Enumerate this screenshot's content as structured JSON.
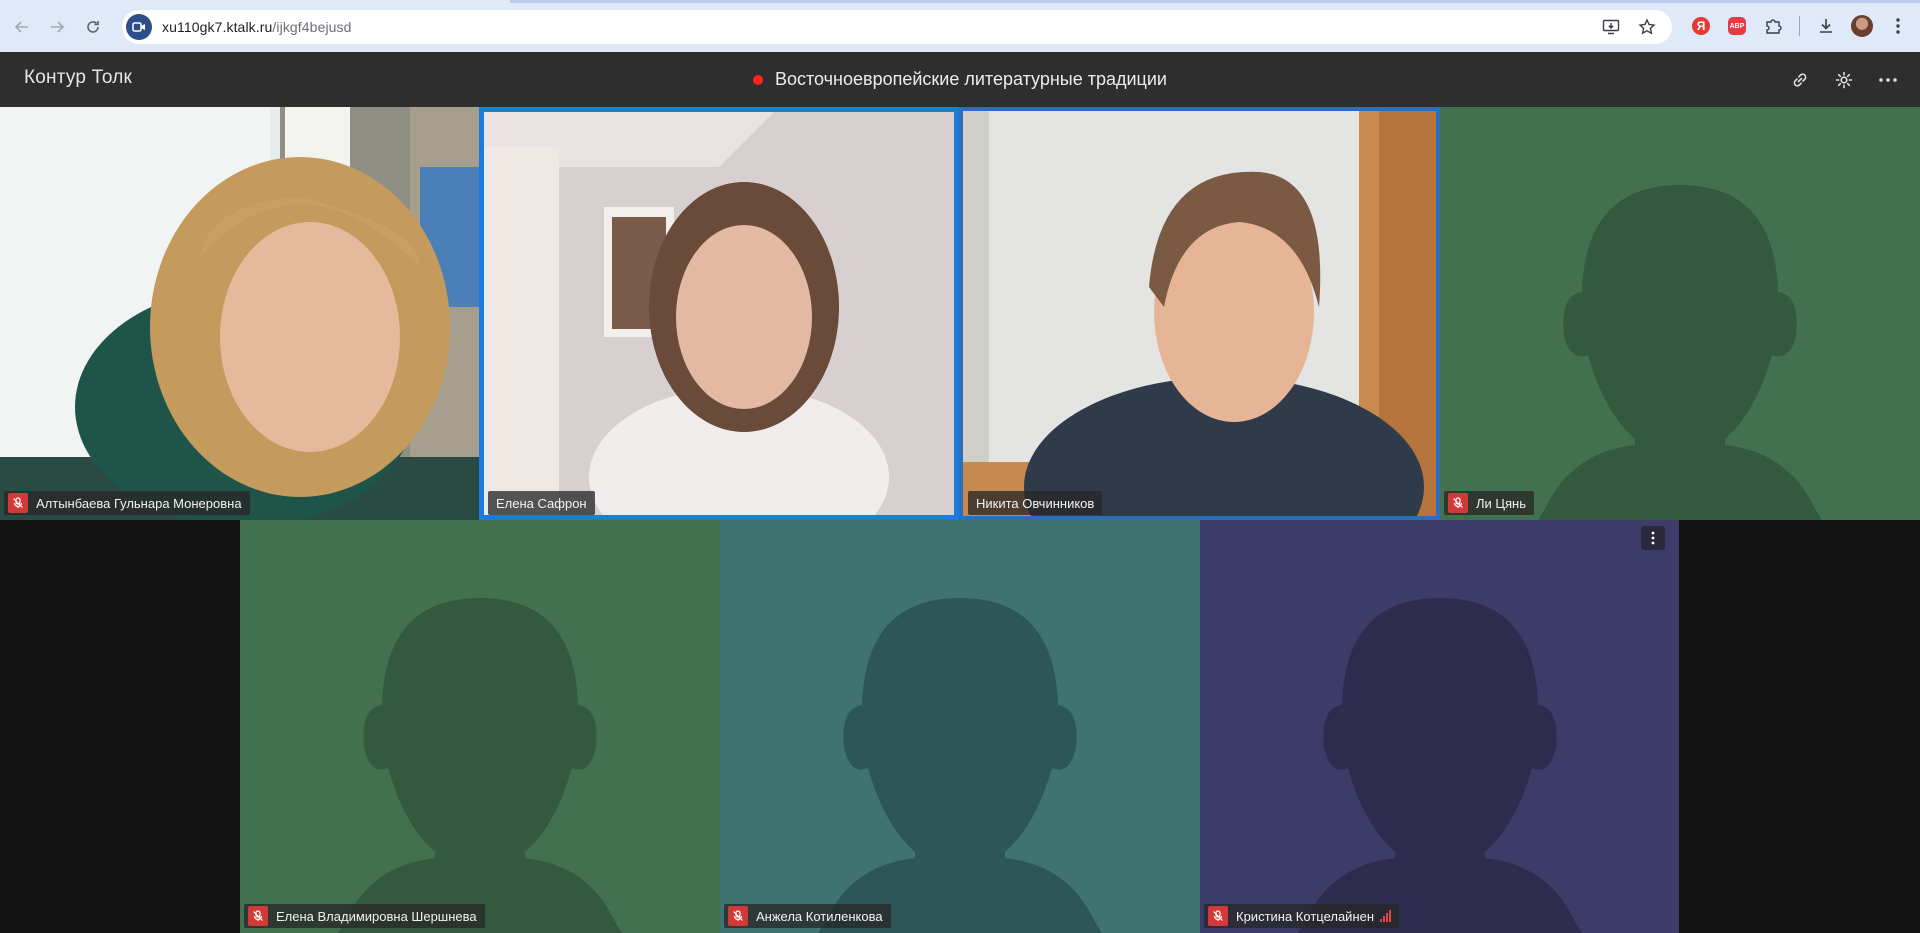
{
  "browser": {
    "url_host": "xu110gk7.ktalk.ru",
    "url_path": "/ijkgf4bejusd",
    "icons": [
      "back-icon",
      "forward-icon",
      "reload-icon",
      "install-app-icon",
      "bookmark-star-icon",
      "yandex-extension-icon",
      "adblock-extension-icon",
      "extensions-puzzle-icon",
      "downloads-icon",
      "profile-avatar",
      "browser-menu-icon"
    ],
    "ext_yandex": "Я",
    "ext_abp": "ABP"
  },
  "header": {
    "app_name": "Контур Толк",
    "meeting_title": "Восточноевропейские литературные традиции",
    "recording_color": "#ff2020",
    "actions": [
      "copy-link-icon",
      "settings-icon",
      "more-icon"
    ]
  },
  "participants": [
    {
      "name": "Алтынбаева Гульнара Монеровна",
      "muted": true,
      "video": true,
      "tile_color": "#6b6f72"
    },
    {
      "name": "Елена Сафрон",
      "muted": false,
      "video": true,
      "speaking": true
    },
    {
      "name": "Никита Овчинников",
      "muted": false,
      "video": true,
      "speaking": true
    },
    {
      "name": "Ли Цянь",
      "muted": true,
      "video": false,
      "tile_color": "#437150"
    },
    {
      "name": "Елена Владимировна Шершнева",
      "muted": true,
      "video": false,
      "tile_color": "#437150"
    },
    {
      "name": "Анжела Котиленкова",
      "muted": true,
      "video": false,
      "tile_color": "#3f7372"
    },
    {
      "name": "Кристина Котцелайнен",
      "muted": true,
      "video": false,
      "tile_color": "#3d3b68",
      "signal_warning": true,
      "menu_icon": "more-vertical-icon"
    }
  ]
}
